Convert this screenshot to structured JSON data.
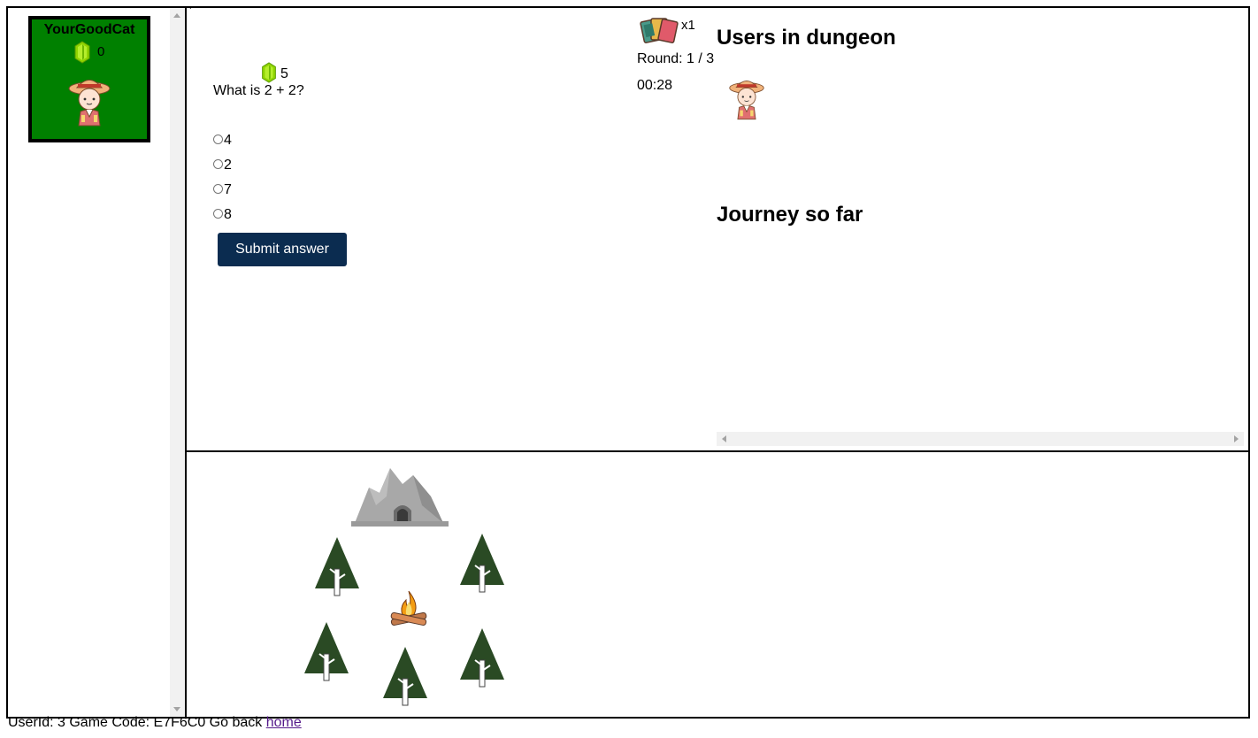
{
  "player": {
    "name": "YourGoodCat",
    "gems": "0",
    "card_color": "#008000",
    "gem_icon": "green-gem-icon",
    "avatar_icon": "explorer-avatar-icon"
  },
  "question": {
    "points": "5",
    "text": "What is 2 + 2?",
    "options": [
      "4",
      "2",
      "7",
      "8"
    ],
    "submit_label": "Submit answer",
    "submit_color": "#0b2c50"
  },
  "status": {
    "cards_icon": "cards-icon",
    "cards_count": "x1",
    "round": "Round: 1 / 3",
    "timer": "00:28"
  },
  "dungeon": {
    "users_title": "Users in dungeon",
    "journey_title": "Journey so far"
  },
  "map": {
    "icons": [
      "cave-icon",
      "campfire-icon",
      "pine-tree-icon"
    ]
  },
  "footer": {
    "text": "UserId: 3 Game Code: E7F6C0 Go back",
    "link_label": "home"
  }
}
